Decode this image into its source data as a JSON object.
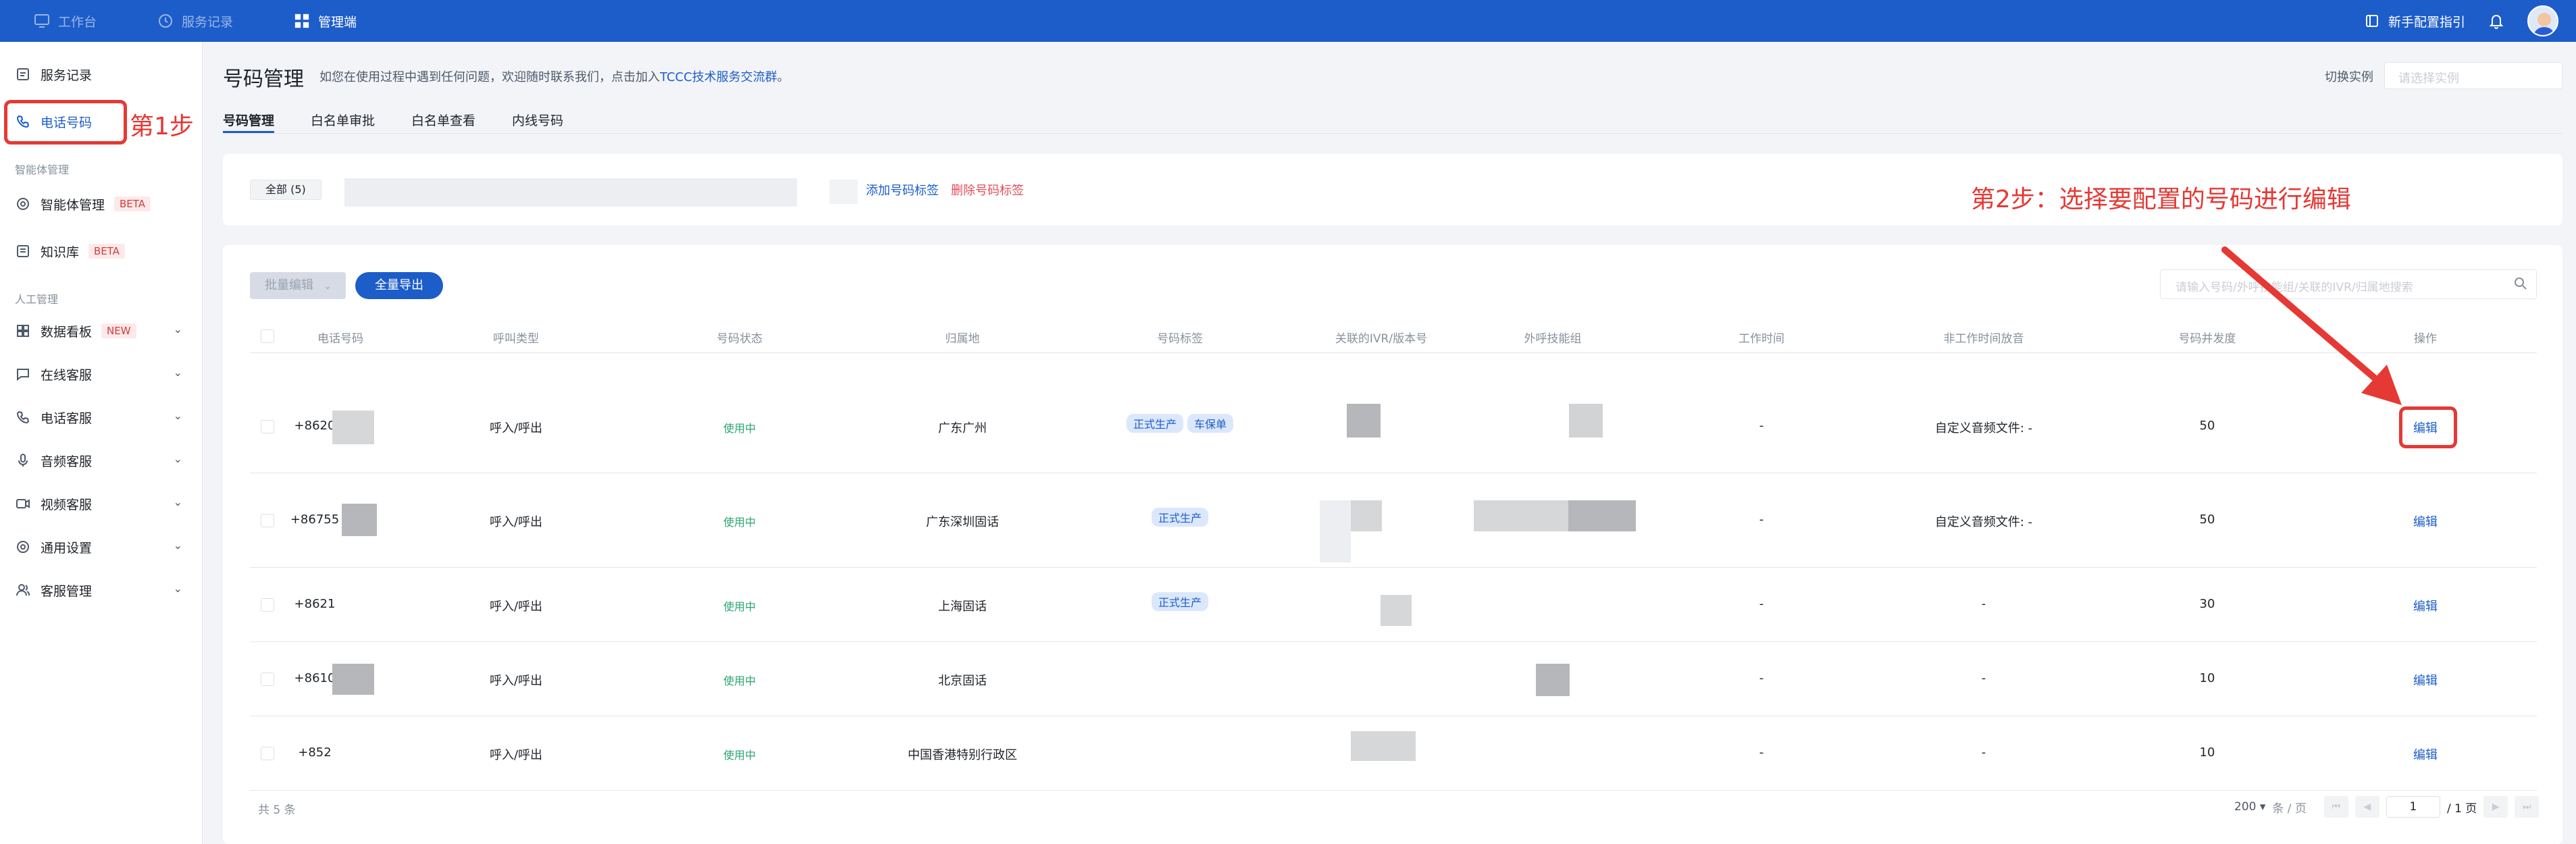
{
  "topbar": {
    "nav": [
      {
        "label": "工作台",
        "icon": "monitor-icon"
      },
      {
        "label": "服务记录",
        "icon": "clock-icon"
      },
      {
        "label": "管理端",
        "icon": "grid-icon"
      }
    ],
    "guide_label": "新手配置指引"
  },
  "sidebar": {
    "items": [
      {
        "label": "服务记录"
      },
      {
        "label": "电话号码"
      }
    ],
    "group_ai": "智能体管理",
    "ai_items": [
      {
        "label": "智能体管理",
        "badge": "BETA"
      },
      {
        "label": "知识库",
        "badge": "BETA"
      }
    ],
    "group_manual": "人工管理",
    "manual_items": [
      {
        "label": "数据看板",
        "badge": "NEW"
      },
      {
        "label": "在线客服"
      },
      {
        "label": "电话客服"
      },
      {
        "label": "音频客服"
      },
      {
        "label": "视频客服"
      },
      {
        "label": "通用设置"
      },
      {
        "label": "客服管理"
      }
    ]
  },
  "header": {
    "title": "号码管理",
    "desc": "如您在使用过程中遇到任何问题，欢迎随时联系我们，点击加入",
    "desc_link": "TCCC技术服务交流群",
    "desc_end": "。",
    "switch_label": "切换实例",
    "switch_placeholder": "请选择实例"
  },
  "tabs": [
    "号码管理",
    "白名单审批",
    "白名单查看",
    "内线号码"
  ],
  "tag_bar": {
    "all": "全部 (5)",
    "add": "添加号码标签",
    "delete": "删除号码标签"
  },
  "toolbar": {
    "batch_edit": "批量编辑",
    "export_all": "全量导出",
    "search_placeholder": "请输入号码/外呼技能组/关联的IVR/归属地搜索"
  },
  "table": {
    "columns": [
      "电话号码",
      "呼叫类型",
      "号码状态",
      "归属地",
      "号码标签",
      "关联的IVR/版本号",
      "外呼技能组",
      "工作时间",
      "非工作时间放音",
      "号码并发度",
      "操作"
    ],
    "rows": [
      {
        "phone": "+8620",
        "type": "呼入/呼出",
        "status": "使用中",
        "region": "广东广州",
        "tags": [
          "正式生产",
          "车保单"
        ],
        "work_time": "-",
        "off_audio": "自定义音频文件: -",
        "concurrency": "50",
        "action": "编辑"
      },
      {
        "phone": "+86755",
        "type": "呼入/呼出",
        "status": "使用中",
        "region": "广东深圳固话",
        "tags": [
          "正式生产"
        ],
        "work_time": "-",
        "off_audio": "自定义音频文件: -",
        "concurrency": "50",
        "action": "编辑"
      },
      {
        "phone": "+8621",
        "type": "呼入/呼出",
        "status": "使用中",
        "region": "上海固话",
        "tags": [
          "正式生产"
        ],
        "work_time": "-",
        "off_audio": "-",
        "concurrency": "30",
        "action": "编辑"
      },
      {
        "phone": "+8610",
        "type": "呼入/呼出",
        "status": "使用中",
        "region": "北京固话",
        "tags": [],
        "work_time": "-",
        "off_audio": "-",
        "concurrency": "10",
        "action": "编辑"
      },
      {
        "phone": "+852",
        "type": "呼入/呼出",
        "status": "使用中",
        "region": "中国香港特别行政区",
        "tags": [],
        "work_time": "-",
        "off_audio": "-",
        "concurrency": "10",
        "action": "编辑"
      }
    ]
  },
  "footer": {
    "total": "共 5 条",
    "page_size": "200",
    "page_size_unit": "条 / 页",
    "page": "1",
    "page_total": "/ 1 页"
  },
  "annotations": {
    "step1": "第1步",
    "step2": "第2步：选择要配置的号码进行编辑"
  },
  "colors": {
    "brand": "#1d5dc9",
    "annotation": "#e53935",
    "status_ok": "#2ba471"
  }
}
